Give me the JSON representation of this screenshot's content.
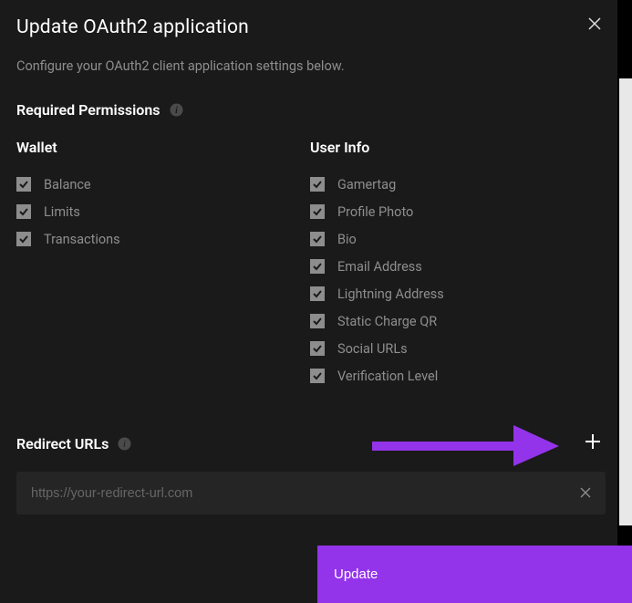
{
  "modal": {
    "title": "Update OAuth2 application",
    "subtitle": "Configure your OAuth2 client application settings below."
  },
  "permissions": {
    "section_title": "Required Permissions",
    "wallet": {
      "title": "Wallet",
      "items": [
        "Balance",
        "Limits",
        "Transactions"
      ]
    },
    "user_info": {
      "title": "User Info",
      "items": [
        "Gamertag",
        "Profile Photo",
        "Bio",
        "Email Address",
        "Lightning Address",
        "Static Charge QR",
        "Social URLs",
        "Verification Level"
      ]
    }
  },
  "redirect": {
    "title": "Redirect URLs",
    "placeholder": "https://your-redirect-url.com"
  },
  "actions": {
    "update_label": "Update"
  },
  "colors": {
    "accent": "#9333ea"
  }
}
